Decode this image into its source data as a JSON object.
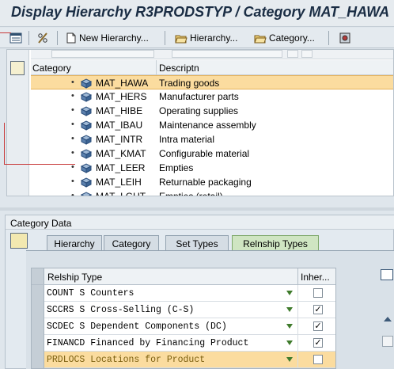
{
  "window": {
    "title": "Display Hierarchy R3PRODSTYP / Category MAT_HAWA"
  },
  "toolbar": {
    "new_hierarchy_label": "New Hierarchy...",
    "hierarchy_label": "Hierarchy...",
    "category_label": "Category..."
  },
  "tree": {
    "columns": {
      "category": "Category",
      "description": "Descriptn"
    },
    "rows": [
      {
        "code": "MAT_HAWA",
        "desc": "Trading goods",
        "selected": true
      },
      {
        "code": "MAT_HERS",
        "desc": "Manufacturer parts"
      },
      {
        "code": "MAT_HIBE",
        "desc": "Operating supplies"
      },
      {
        "code": "MAT_IBAU",
        "desc": "Maintenance assembly"
      },
      {
        "code": "MAT_INTR",
        "desc": "Intra material"
      },
      {
        "code": "MAT_KMAT",
        "desc": "Configurable material"
      },
      {
        "code": "MAT_LEER",
        "desc": "Empties"
      },
      {
        "code": "MAT_LEIH",
        "desc": "Returnable packaging"
      },
      {
        "code": "MAT_LGUT",
        "desc": "Empties (retail)"
      }
    ]
  },
  "category_data": {
    "title": "Category Data",
    "tabs": [
      "Hierarchy",
      "Category",
      "Set Types",
      "Relnship Types"
    ],
    "active_tab": "Relnship Types",
    "grid": {
      "col_type": "Relship Type",
      "col_inherited": "Inher...",
      "rows": [
        {
          "type": "COUNT S Counters",
          "checked": false
        },
        {
          "type": "SCCRS S Cross-Selling (C-S)",
          "checked": true
        },
        {
          "type": "SCDEC S Dependent Components (DC)",
          "checked": true
        },
        {
          "type": "FINANCD Financed by Financing Product",
          "checked": true
        },
        {
          "type": "PRDLOCS Locations for Product",
          "checked": false,
          "selected": true
        }
      ]
    }
  },
  "colors": {
    "selection": "#fbdc9f",
    "active_tab": "#cfe5c2",
    "panel": "#dfe6ec"
  }
}
